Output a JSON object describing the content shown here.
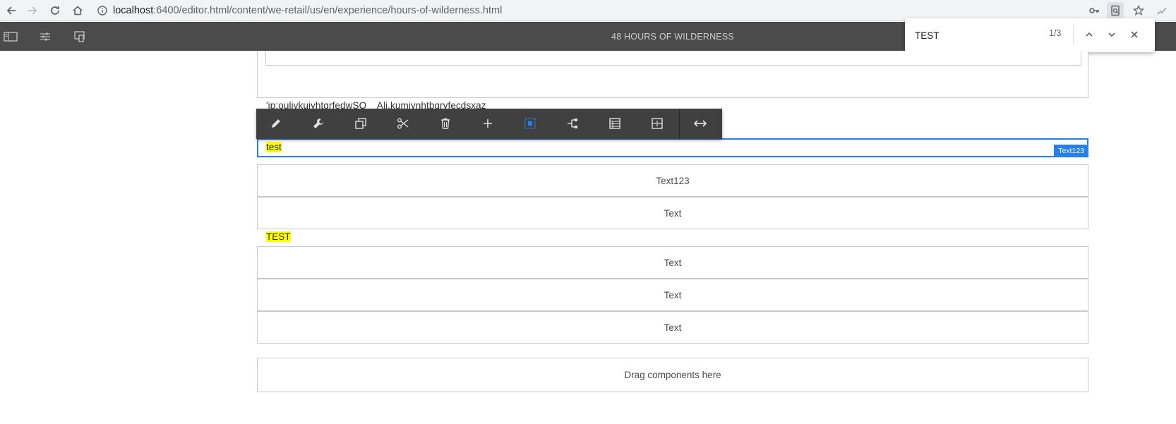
{
  "browser": {
    "url_host": "localhost",
    "url_path": ":6400/editor.html/content/we-retail/us/en/experience/hours-of-wilderness.html"
  },
  "editor": {
    "page_title": "48 HOURS OF WILDERNESS"
  },
  "find": {
    "query": "TEST",
    "count": "1/3"
  },
  "content": {
    "partial_text": "'jp:oulivkuiyhtgrfedwSQ    Alj.kumiynhtbgryfecdsxaz",
    "selected_text": "test",
    "selected_label": "Text123",
    "components_group1": [
      {
        "label": "Text123"
      },
      {
        "label": "Text"
      }
    ],
    "highlighted_text": "TEST",
    "components_group2": [
      {
        "label": "Text"
      },
      {
        "label": "Text"
      },
      {
        "label": "Text"
      }
    ],
    "drop_zone": "Drag components here"
  },
  "colors": {
    "accent": "#2680eb",
    "toolbar": "#4b4b4b",
    "highlight": "#ffff00"
  }
}
